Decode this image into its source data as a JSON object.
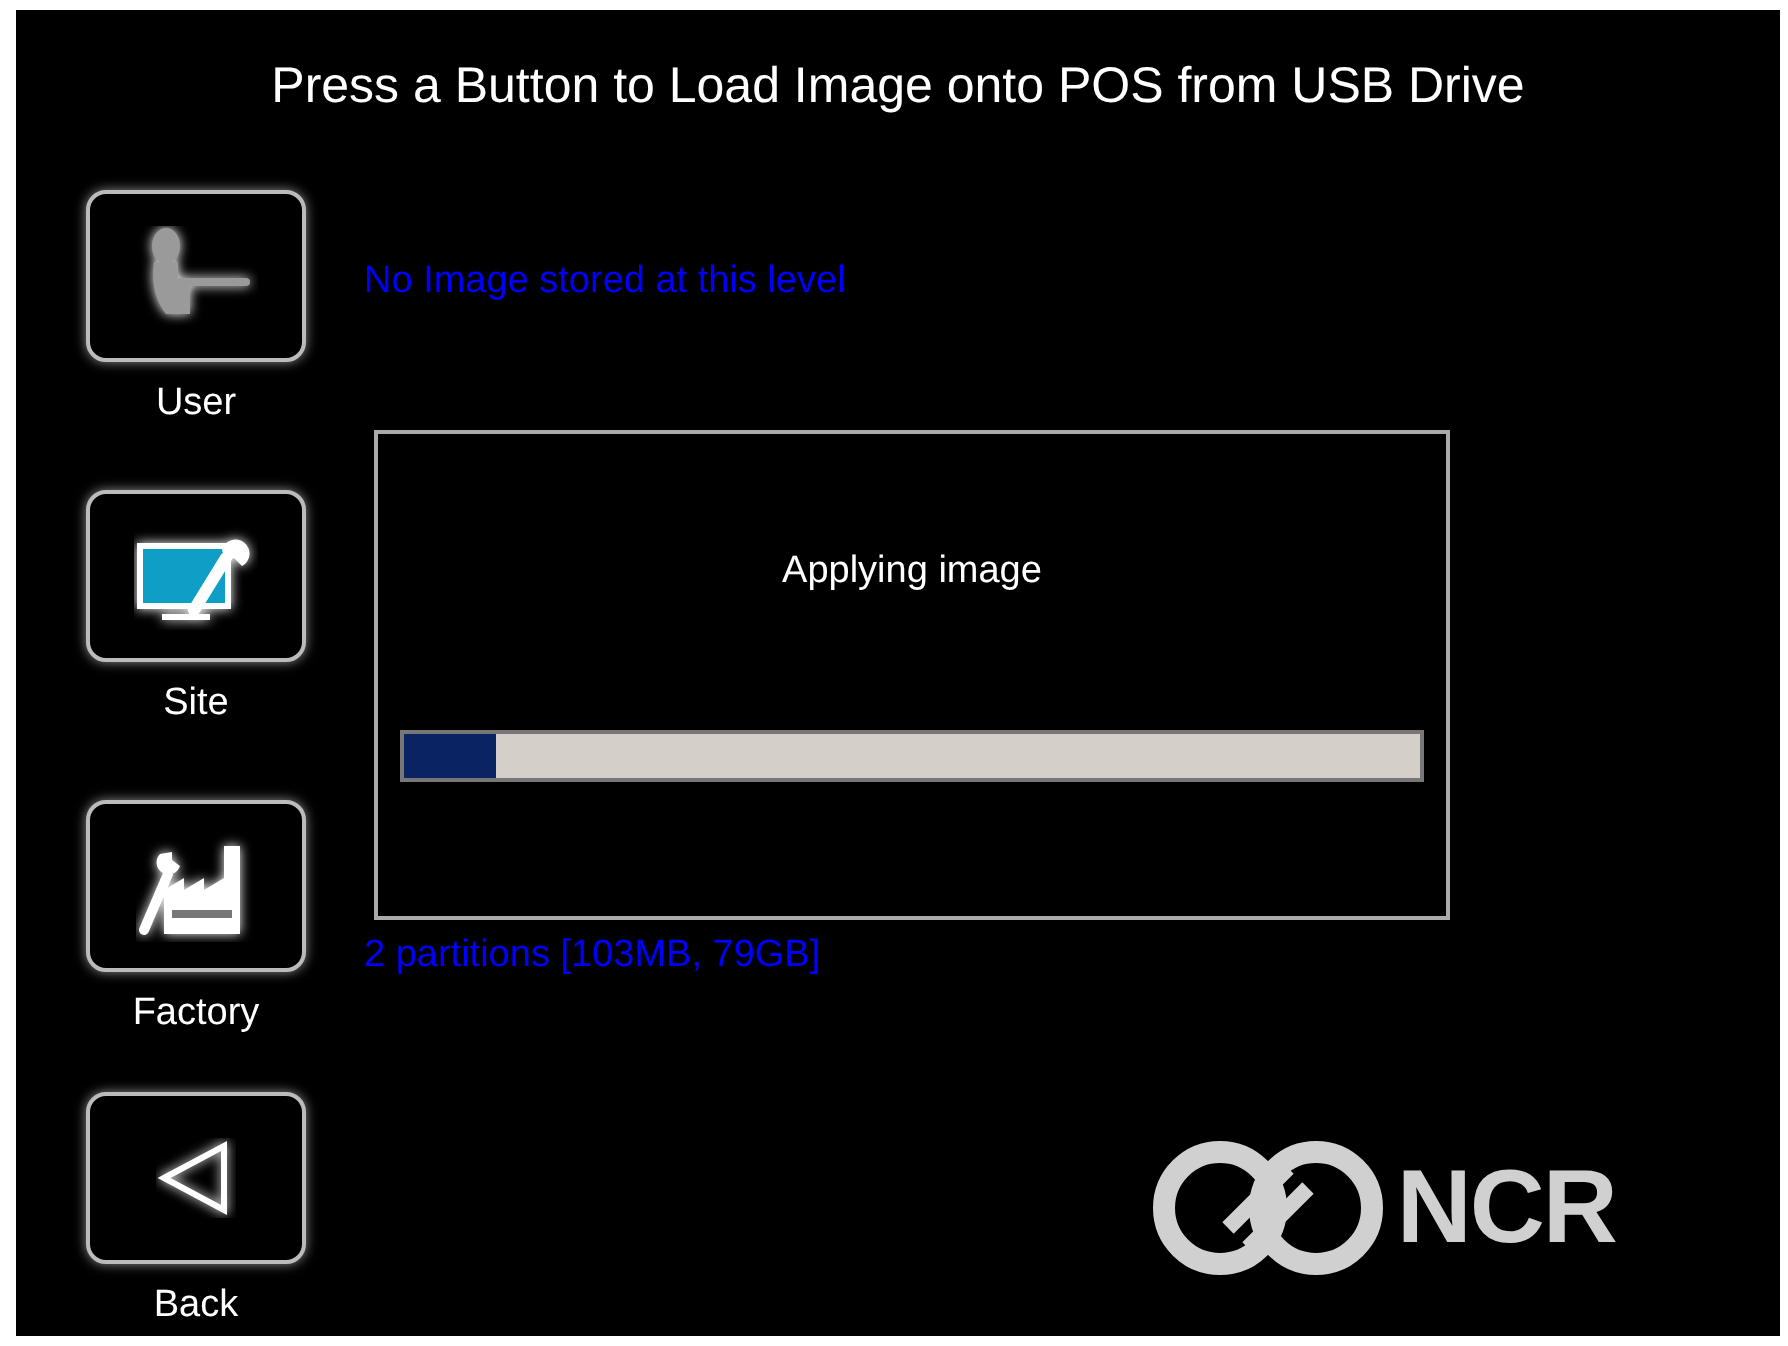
{
  "title": "Press a Button to Load Image onto POS from USB Drive",
  "levels": [
    {
      "label": "User",
      "kind": "user",
      "lines": [
        "No Image stored at this level"
      ]
    },
    {
      "label": "Site",
      "kind": "site"
    },
    {
      "label": "Factory",
      "kind": "factory",
      "lines": [
        "2 partitions [103MB, 79GB]"
      ]
    },
    {
      "label": "Back",
      "kind": "back"
    }
  ],
  "dialog": {
    "message": "Applying image",
    "progress": {
      "level": 0.09
    }
  },
  "logo": {
    "text": "NCR"
  }
}
